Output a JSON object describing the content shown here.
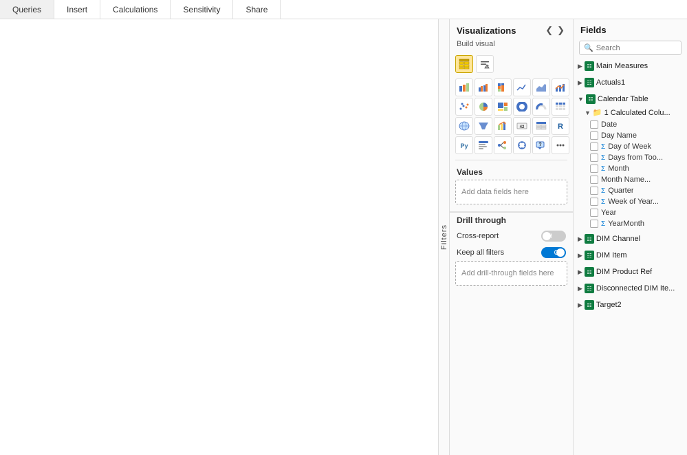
{
  "toolbar": {
    "tabs": [
      "Queries",
      "Insert",
      "Calculations",
      "Sensitivity",
      "Share"
    ]
  },
  "filters": {
    "label": "Filters"
  },
  "visualizations": {
    "title": "Visualizations",
    "build_visual": "Build visual",
    "values_label": "Values",
    "values_placeholder": "Add data fields here",
    "drill_through_label": "Drill through",
    "cross_report_label": "Cross-report",
    "cross_report_state": "Off",
    "keep_all_filters_label": "Keep all filters",
    "keep_all_filters_state": "On",
    "drill_placeholder": "Add drill-through fields here"
  },
  "fields": {
    "title": "Fields",
    "search_placeholder": "Search",
    "groups": [
      {
        "name": "Main Measures",
        "expanded": false,
        "items": []
      },
      {
        "name": "Actuals1",
        "expanded": false,
        "items": []
      },
      {
        "name": "Calendar Table",
        "expanded": true,
        "subgroups": [
          {
            "name": "1 Calculated Colu...",
            "expanded": true
          }
        ],
        "items": [
          {
            "name": "Date",
            "type": "field",
            "checked": false
          },
          {
            "name": "Day Name",
            "type": "field",
            "checked": false
          },
          {
            "name": "Day of Week",
            "type": "sigma",
            "checked": false
          },
          {
            "name": "Days from Too...",
            "type": "sigma",
            "checked": false
          },
          {
            "name": "Month",
            "type": "sigma",
            "checked": false
          },
          {
            "name": "Month Name...",
            "type": "field",
            "checked": false
          },
          {
            "name": "Quarter",
            "type": "sigma",
            "checked": false
          },
          {
            "name": "Week of Year...",
            "type": "sigma",
            "checked": false
          },
          {
            "name": "Year",
            "type": "field",
            "checked": false
          },
          {
            "name": "YearMonth",
            "type": "sigma",
            "checked": false
          }
        ]
      },
      {
        "name": "DIM Channel",
        "expanded": false,
        "items": []
      },
      {
        "name": "DIM Item",
        "expanded": false,
        "items": []
      },
      {
        "name": "DIM Product Ref",
        "expanded": false,
        "items": []
      },
      {
        "name": "Disconnected DIM Ite...",
        "expanded": false,
        "items": []
      },
      {
        "name": "Target2",
        "expanded": false,
        "items": []
      }
    ]
  }
}
